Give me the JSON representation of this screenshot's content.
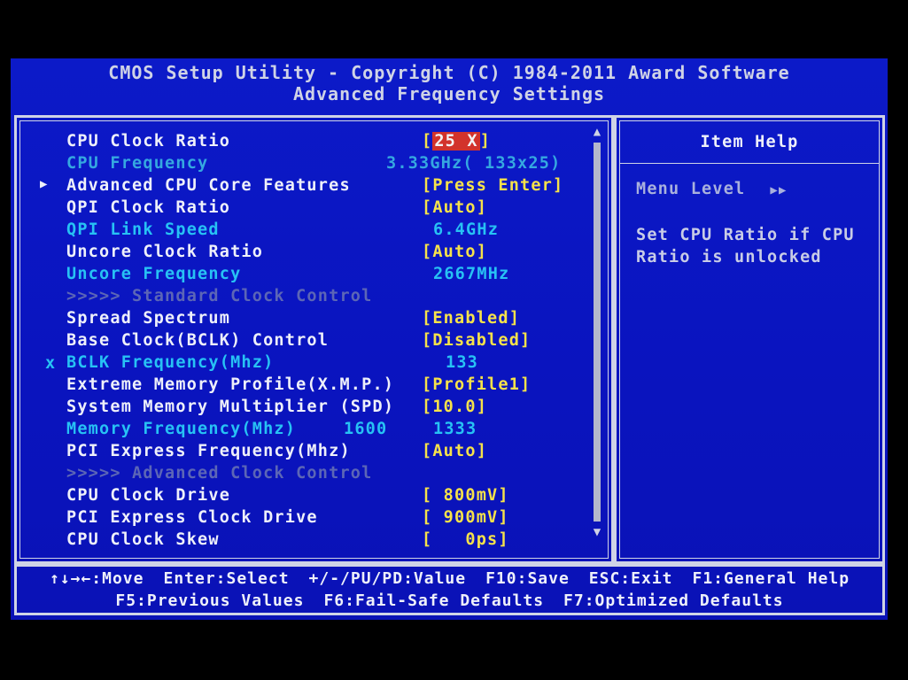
{
  "header": {
    "line1": "CMOS Setup Utility - Copyright (C) 1984-2011 Award Software",
    "line2": "Advanced Frequency Settings"
  },
  "items": [
    {
      "marker": "",
      "name": "CPU Clock Ratio",
      "extra": "",
      "value_prefix": "[",
      "value_selected": "25 X",
      "value_suffix": "]",
      "value": ""
    },
    {
      "marker": "",
      "name": "CPU Frequency",
      "extra": "",
      "value": "3.33GHz( 133x25)"
    },
    {
      "marker": "▶",
      "name": "Advanced CPU Core Features",
      "extra": "",
      "value": "[Press Enter]"
    },
    {
      "marker": "",
      "name": "QPI Clock Ratio",
      "extra": "",
      "value": "[Auto]"
    },
    {
      "marker": "",
      "name": "QPI Link Speed",
      "extra": "",
      "value": "6.4GHz"
    },
    {
      "marker": "",
      "name": "Uncore Clock Ratio",
      "extra": "",
      "value": "[Auto]"
    },
    {
      "marker": "",
      "name": "Uncore Frequency",
      "extra": "",
      "value": "2667MHz"
    },
    {
      "marker": "",
      "name": ">>>>>  Standard Clock Control",
      "extra": "",
      "value": ""
    },
    {
      "marker": "",
      "name": "Spread Spectrum",
      "extra": "",
      "value": "[Enabled]"
    },
    {
      "marker": "",
      "name": "Base Clock(BCLK) Control",
      "extra": "",
      "value": "[Disabled]"
    },
    {
      "marker": "x",
      "name": "BCLK Frequency(Mhz)",
      "extra": "",
      "value": "133"
    },
    {
      "marker": "",
      "name": "Extreme Memory Profile(X.M.P.)",
      "extra": "",
      "value": "[Profile1]"
    },
    {
      "marker": "",
      "name": "System Memory Multiplier (SPD)",
      "extra": "",
      "value": "[10.0]"
    },
    {
      "marker": "",
      "name": "Memory Frequency(Mhz)",
      "extra": "1600",
      "value": "1333"
    },
    {
      "marker": "",
      "name": "PCI Express Frequency(Mhz)",
      "extra": "",
      "value": "[Auto]"
    },
    {
      "marker": "",
      "name": ">>>>>  Advanced Clock Control",
      "extra": "",
      "value": ""
    },
    {
      "marker": "",
      "name": "CPU Clock Drive",
      "extra": "",
      "value": "[ 800mV]"
    },
    {
      "marker": "",
      "name": "PCI Express Clock Drive",
      "extra": "",
      "value": "[ 900mV]"
    },
    {
      "marker": "",
      "name": "CPU Clock Skew",
      "extra": "",
      "value": "[   0ps]"
    }
  ],
  "scrollbar": {
    "up": "▲",
    "down": "▼"
  },
  "help": {
    "title": "Item Help",
    "menu_level_label": "Menu Level",
    "menu_level_symbol": "▶▶",
    "text": "Set CPU Ratio if CPU Ratio is unlocked"
  },
  "footer": {
    "move": "↑↓→←:Move",
    "select": "Enter:Select",
    "value": "+/-/PU/PD:Value",
    "save": "F10:Save",
    "exit": "ESC:Exit",
    "general_help": "F1:General Help",
    "previous": "F5:Previous Values",
    "failsafe": "F6:Fail-Safe Defaults",
    "optimized": "F7:Optimized Defaults"
  },
  "colors": {
    "background": "#0b16c4",
    "normal_text": "#eef0fa",
    "value_text": "#f6e24a",
    "readonly_text": "#27c2f4",
    "disabled_text": "#5c66b6",
    "selection": "#d2332b"
  }
}
